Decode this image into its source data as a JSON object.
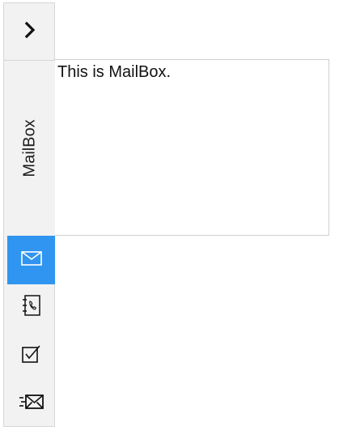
{
  "nav": {
    "toggle_icon": "chevron-right-icon",
    "section_title": "MailBox",
    "items": [
      {
        "name": "mailbox",
        "icon": "mail-icon",
        "active": true
      },
      {
        "name": "contacts",
        "icon": "contact-book-icon",
        "active": false
      },
      {
        "name": "tasks",
        "icon": "checkbox-icon",
        "active": false
      },
      {
        "name": "send",
        "icon": "send-mail-icon",
        "active": false
      }
    ]
  },
  "content": {
    "text": "This is MailBox."
  },
  "colors": {
    "accent": "#2f95f0",
    "nav_background": "#f2f2f2",
    "border": "#d6d6d6"
  }
}
